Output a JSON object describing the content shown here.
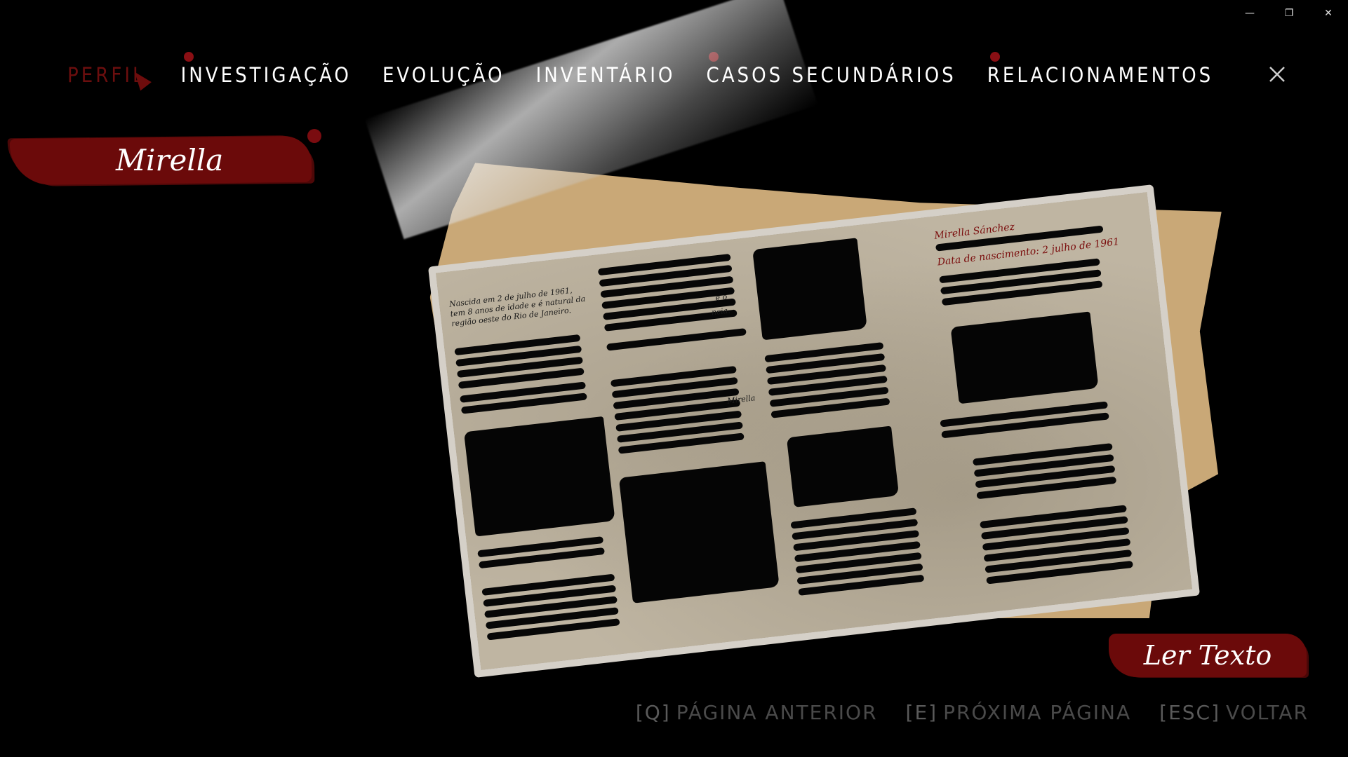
{
  "window": {
    "minimize_icon": "minimize-icon",
    "restore_icon": "restore-icon",
    "close_icon": "close-icon",
    "minimize_glyph": "—",
    "restore_glyph": "❐",
    "close_glyph": "✕"
  },
  "nav": {
    "tabs": [
      {
        "label": "PERFIL",
        "state": "active",
        "dot": false
      },
      {
        "label": "INVESTIGAÇÃO",
        "state": "hovered",
        "dot": true
      },
      {
        "label": "EVOLUÇÃO",
        "state": "normal",
        "dot": false
      },
      {
        "label": "INVENTÁRIO",
        "state": "normal",
        "dot": false
      },
      {
        "label": "CASOS SECUNDÁRIOS",
        "state": "normal",
        "dot": true
      },
      {
        "label": "RELACIONAMENTOS",
        "state": "normal",
        "dot": true
      }
    ]
  },
  "profile": {
    "name": "Mirella"
  },
  "document": {
    "intro_text": "Nascida em 2 de julho de 1961, tem 8 anos de idade e é natural da região oeste do Rio de Janeiro.",
    "header_name": "Mirella Sánchez",
    "birth_line": "Data de nascimento: 2 julho de 1961",
    "fragment_1": "e o",
    "fragment_2": "ncia.",
    "fragment_3": "Mirella"
  },
  "actions": {
    "read_text": "Ler Texto"
  },
  "footer": {
    "prev": {
      "key": "[Q]",
      "label": "PÁGINA ANTERIOR"
    },
    "next": {
      "key": "[E]",
      "label": "PRÓXIMA PÁGINA"
    },
    "back": {
      "key": "[ESC]",
      "label": "VOLTAR"
    }
  },
  "colors": {
    "accent_red": "#6b0a0a",
    "background": "#000000",
    "hint_gray": "#4a4a4a",
    "paper": "#bfb5a2",
    "cardboard": "#c9a877"
  }
}
